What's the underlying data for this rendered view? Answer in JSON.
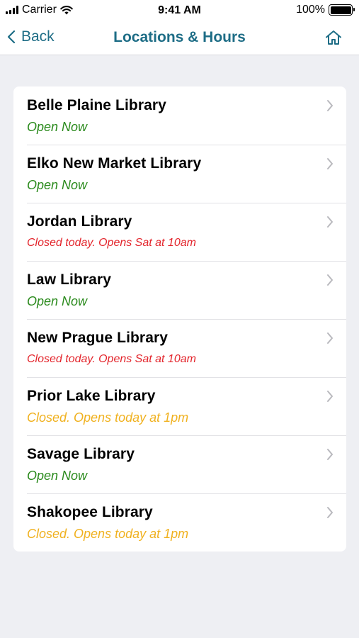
{
  "status_bar": {
    "carrier": "Carrier",
    "time": "9:41 AM",
    "battery": "100%"
  },
  "nav": {
    "back_label": "Back",
    "title": "Locations & Hours"
  },
  "locations": [
    {
      "name": "Belle Plaine Library",
      "status": "Open Now",
      "status_type": "open"
    },
    {
      "name": "Elko New Market Library",
      "status": "Open Now",
      "status_type": "open"
    },
    {
      "name": "Jordan Library",
      "status": "Closed today. Opens Sat at 10am",
      "status_type": "closed-red"
    },
    {
      "name": "Law Library",
      "status": "Open Now",
      "status_type": "open"
    },
    {
      "name": "New Prague Library",
      "status": "Closed today. Opens Sat at 10am",
      "status_type": "closed-red"
    },
    {
      "name": "Prior Lake Library",
      "status": "Closed. Opens today at 1pm",
      "status_type": "closed-yellow"
    },
    {
      "name": "Savage Library",
      "status": "Open Now",
      "status_type": "open"
    },
    {
      "name": "Shakopee Library",
      "status": "Closed. Opens today at 1pm",
      "status_type": "closed-yellow"
    }
  ],
  "colors": {
    "accent": "#1e6d86",
    "open": "#2a8a1c",
    "closed_red": "#e3242b",
    "closed_yellow": "#f0b11f",
    "background": "#eeeff3"
  }
}
